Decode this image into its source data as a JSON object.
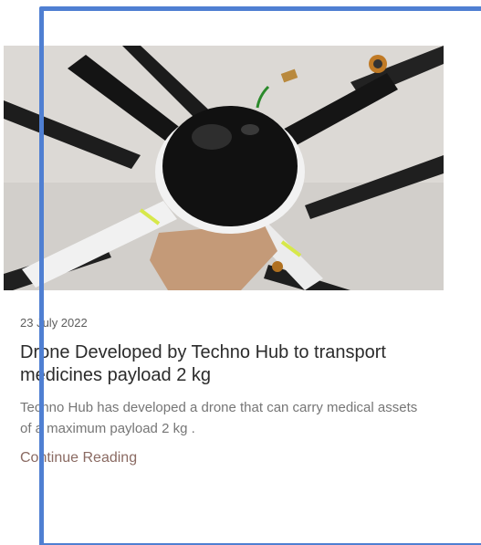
{
  "post": {
    "image_alt": "Drone",
    "date": "23 July 2022",
    "title": "Drone Developed by Techno Hub to transport medicines payload 2 kg",
    "excerpt": "Techno Hub has developed a drone that can carry medical assets of a maximum payload 2 kg .",
    "read_more_label": "Continue Reading"
  },
  "colors": {
    "frame": "#4f7fd2",
    "link": "#8a6a62",
    "title": "#2b2b2b",
    "excerpt": "#767676"
  }
}
